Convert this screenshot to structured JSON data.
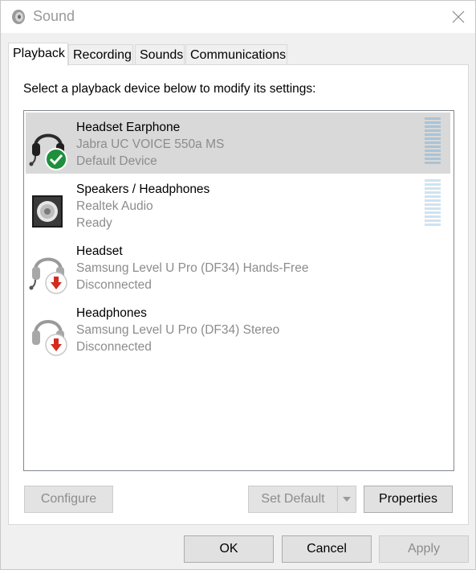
{
  "window": {
    "title": "Sound"
  },
  "tabs": [
    {
      "label": "Playback",
      "active": true
    },
    {
      "label": "Recording",
      "active": false
    },
    {
      "label": "Sounds",
      "active": false
    },
    {
      "label": "Communications",
      "active": false
    }
  ],
  "playback": {
    "instruction": "Select a playback device below to modify its settings:",
    "devices": [
      {
        "name": "Headset Earphone",
        "model": "Jabra UC VOICE 550a MS",
        "status": "Default Device",
        "icon": "headset-icon",
        "badge": "default-check-icon",
        "selected": true
      },
      {
        "name": "Speakers / Headphones",
        "model": "Realtek Audio",
        "status": "Ready",
        "icon": "speaker-icon",
        "badge": "",
        "selected": false
      },
      {
        "name": "Headset",
        "model": "Samsung Level U Pro (DF34) Hands-Free",
        "status": "Disconnected",
        "icon": "headset-icon",
        "badge": "disconnected-arrow-icon",
        "selected": false
      },
      {
        "name": "Headphones",
        "model": "Samsung Level U Pro (DF34) Stereo",
        "status": "Disconnected",
        "icon": "headphones-icon",
        "badge": "disconnected-arrow-icon",
        "selected": false
      }
    ],
    "buttons": {
      "configure": "Configure",
      "set_default": "Set Default",
      "properties": "Properties"
    }
  },
  "footer": {
    "ok": "OK",
    "cancel": "Cancel",
    "apply": "Apply"
  },
  "colors": {
    "selected_row": "#d9d9d9",
    "check_badge": "#1e8f3c",
    "disconnect_badge": "#d52b1e",
    "meter": "#a9c4d6"
  }
}
